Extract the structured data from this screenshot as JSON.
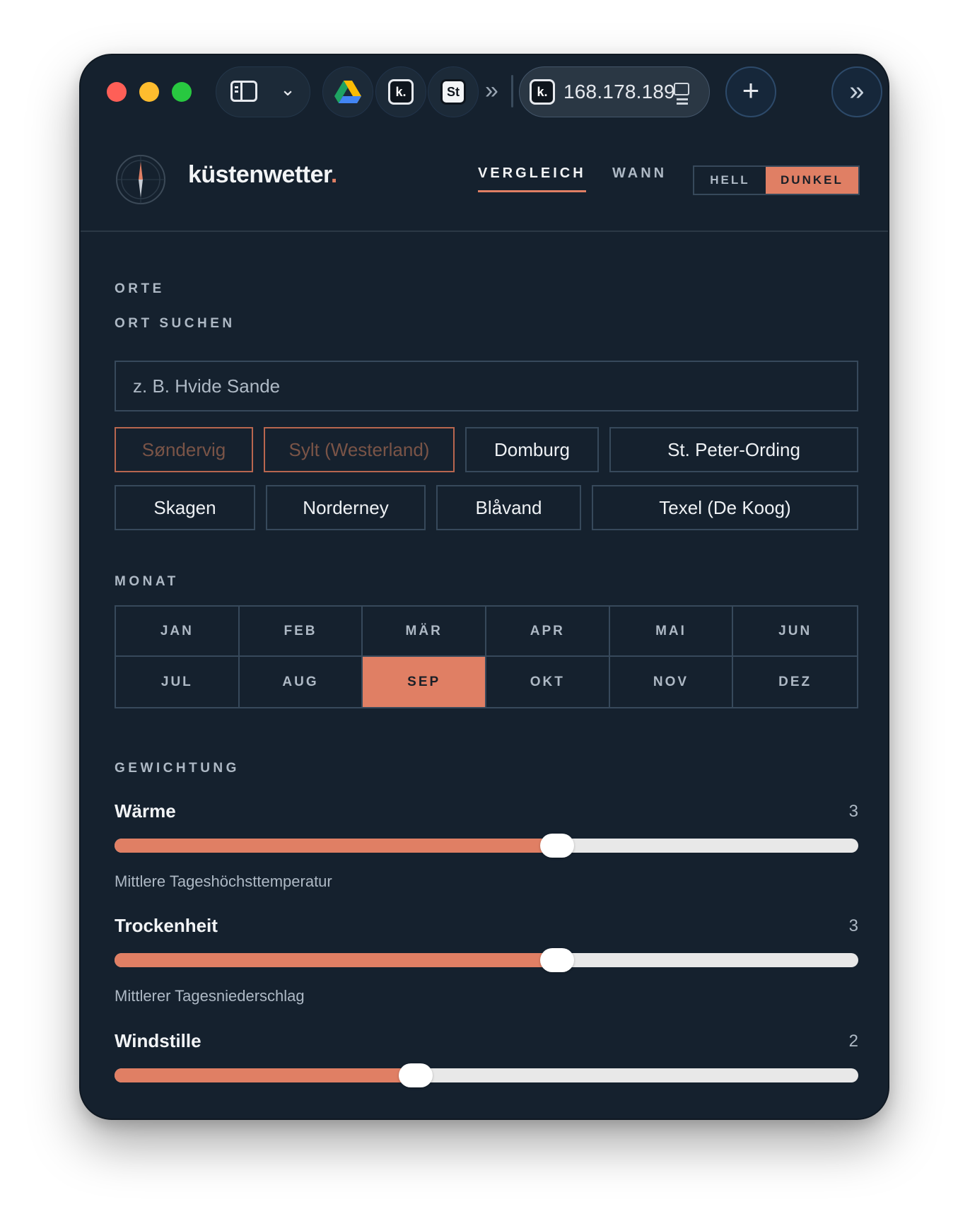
{
  "browser": {
    "url": "168.178.189",
    "tabs": [
      {
        "icon": "google-drive-icon"
      },
      {
        "icon": "k-app-icon",
        "glyph": "k."
      },
      {
        "icon": "st-app-icon",
        "glyph": "St"
      }
    ],
    "active_tab_glyph": "k."
  },
  "header": {
    "brand": "küstenwetter",
    "brand_dot": ".",
    "nav": [
      {
        "label": "VERGLEICH",
        "active": true
      },
      {
        "label": "WANN",
        "active": false
      }
    ],
    "theme": {
      "light": "HELL",
      "dark": "DUNKEL",
      "selected": "DUNKEL"
    }
  },
  "orte": {
    "title": "ORTE",
    "search_label": "ORT SUCHEN",
    "search_placeholder": "z. B. Hvide Sande",
    "places": [
      {
        "label": "Søndervig",
        "selected": true
      },
      {
        "label": "Sylt (Westerland)",
        "selected": true
      },
      {
        "label": "Domburg",
        "selected": false
      },
      {
        "label": "St. Peter-Ording",
        "selected": false
      },
      {
        "label": "Skagen",
        "selected": false
      },
      {
        "label": "Norderney",
        "selected": false
      },
      {
        "label": "Blåvand",
        "selected": false
      },
      {
        "label": "Texel (De Koog)",
        "selected": false
      }
    ]
  },
  "monat": {
    "title": "MONAT",
    "months": [
      "JAN",
      "FEB",
      "MÄR",
      "APR",
      "MAI",
      "JUN",
      "JUL",
      "AUG",
      "SEP",
      "OKT",
      "NOV",
      "DEZ"
    ],
    "selected": "SEP"
  },
  "gewichtung": {
    "title": "GEWICHTUNG",
    "items": [
      {
        "label": "Wärme",
        "value": "3",
        "fraction": 0.595,
        "description": "Mittlere Tageshöchsttemperatur"
      },
      {
        "label": "Trockenheit",
        "value": "3",
        "fraction": 0.595,
        "description": "Mittlerer Tagesniederschlag"
      },
      {
        "label": "Windstille",
        "value": "2",
        "fraction": 0.405,
        "description": ""
      }
    ]
  },
  "colors": {
    "accent": "#e07f64",
    "background": "#15212e"
  }
}
